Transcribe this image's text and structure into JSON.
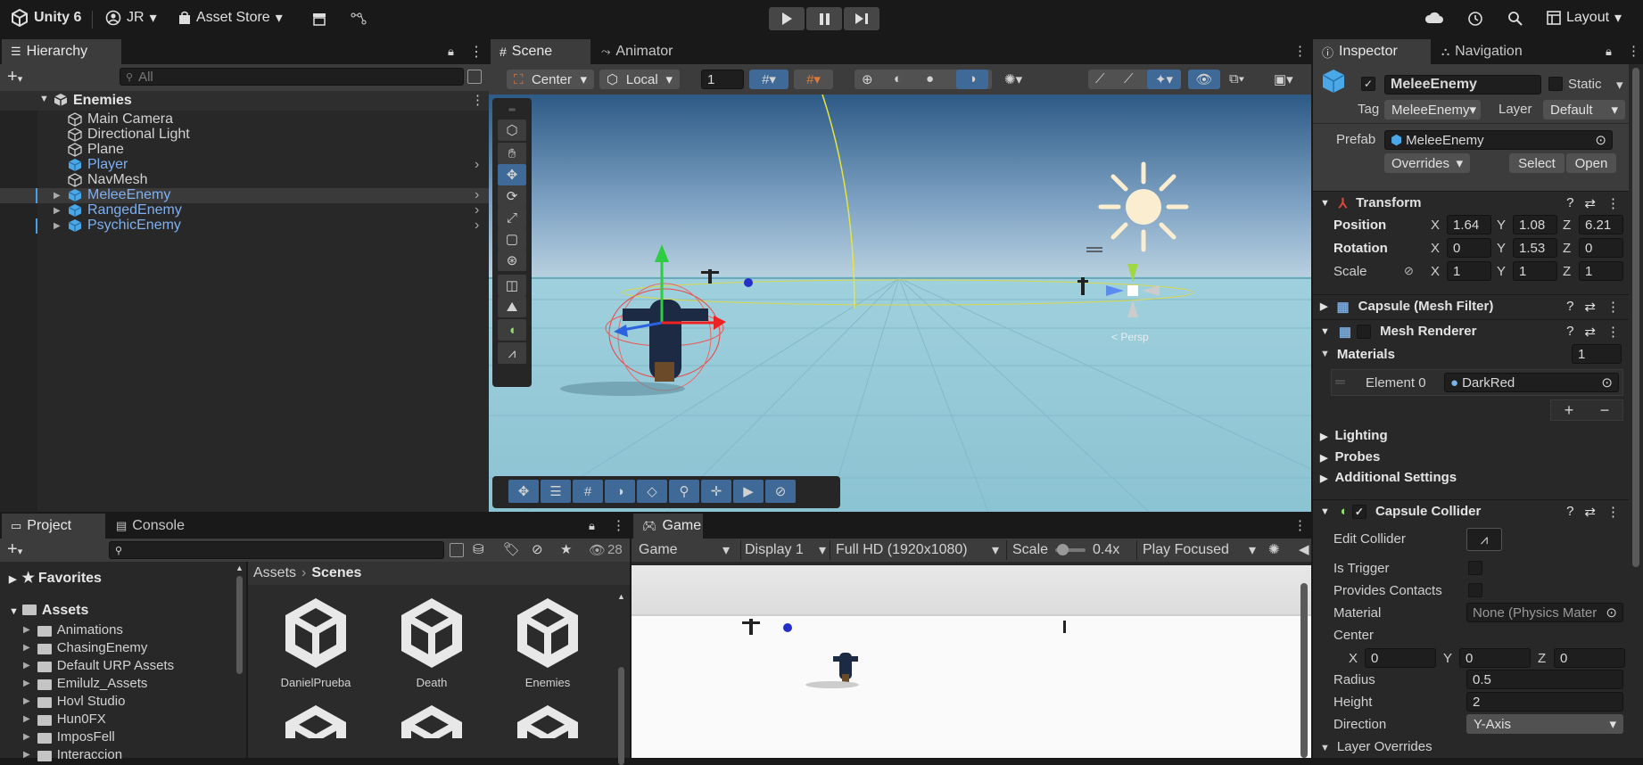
{
  "app": {
    "name": "Unity 6",
    "account": "JR",
    "asset_store": "Asset Store",
    "layout": "Layout"
  },
  "hierarchy": {
    "tab": "Hierarchy",
    "search_placeholder": "All",
    "scene": "Enemies",
    "items": [
      {
        "label": "Main Camera",
        "prefab": false
      },
      {
        "label": "Directional Light",
        "prefab": false
      },
      {
        "label": "Plane",
        "prefab": false
      },
      {
        "label": "Player",
        "prefab": true
      },
      {
        "label": "NavMesh",
        "prefab": false
      },
      {
        "label": "MeleeEnemy",
        "prefab": true
      },
      {
        "label": "RangedEnemy",
        "prefab": true
      },
      {
        "label": "PsychicEnemy",
        "prefab": true
      }
    ]
  },
  "scene": {
    "tabs": [
      "Scene",
      "Animator"
    ],
    "pivot": "Center",
    "space": "Local",
    "grid_snap": "1",
    "gizmo_back_label": "< Persp"
  },
  "project": {
    "tabs": [
      "Project",
      "Console"
    ],
    "hidden_count": "28",
    "favorites": "Favorites",
    "assets": "Assets",
    "folders": [
      "Animations",
      "ChasingEnemy",
      "Default URP Assets",
      "Emilulz_Assets",
      "Hovl Studio",
      "Hun0FX",
      "ImposFell",
      "Interaccion"
    ],
    "breadcrumb": [
      "Assets",
      "Scenes"
    ],
    "scene_files": [
      "DanielPrueba",
      "Death",
      "Enemies"
    ]
  },
  "game": {
    "tab": "Game",
    "view": "Game",
    "display": "Display 1",
    "resolution": "Full HD (1920x1080)",
    "scale_label": "Scale",
    "scale_value": "0.4x",
    "play_mode": "Play Focused"
  },
  "inspector": {
    "tabs": [
      "Inspector",
      "Navigation"
    ],
    "object_name": "MeleeEnemy",
    "static_label": "Static",
    "tag_label": "Tag",
    "tag_value": "MeleeEnemy",
    "layer_label": "Layer",
    "layer_value": "Default",
    "prefab_label": "Prefab",
    "prefab_value": "MeleeEnemy",
    "overrides": "Overrides",
    "select": "Select",
    "open": "Open",
    "transform": {
      "title": "Transform",
      "position_label": "Position",
      "position": [
        "1.64",
        "1.08",
        "6.21"
      ],
      "rotation_label": "Rotation",
      "rotation": [
        "0",
        "1.53",
        "0"
      ],
      "scale_label": "Scale",
      "scale": [
        "1",
        "1",
        "1"
      ]
    },
    "axes": [
      "X",
      "Y",
      "Z"
    ],
    "mesh_filter": "Capsule (Mesh Filter)",
    "mesh_renderer": "Mesh Renderer",
    "materials_label": "Materials",
    "materials_count": "1",
    "element0_label": "Element 0",
    "element0_value": "DarkRed",
    "plus": "+",
    "minus": "−",
    "lighting": "Lighting",
    "probes": "Probes",
    "additional_settings": "Additional Settings",
    "collider": {
      "title": "Capsule Collider",
      "edit_label": "Edit Collider",
      "is_trigger": "Is Trigger",
      "provides_contacts": "Provides Contacts",
      "material_label": "Material",
      "material_value": "None (Physics Mater",
      "center_label": "Center",
      "center": [
        "0",
        "0",
        "0"
      ],
      "radius_label": "Radius",
      "radius": "0.5",
      "height_label": "Height",
      "height": "2",
      "direction_label": "Direction",
      "direction": "Y-Axis"
    },
    "layer_overrides": "Layer Overrides"
  },
  "colors": {
    "accent_blue": "#3f6996",
    "prefab_blue": "#7fb0f2",
    "panel": "#282828",
    "toolbar": "#3c3c3c"
  }
}
